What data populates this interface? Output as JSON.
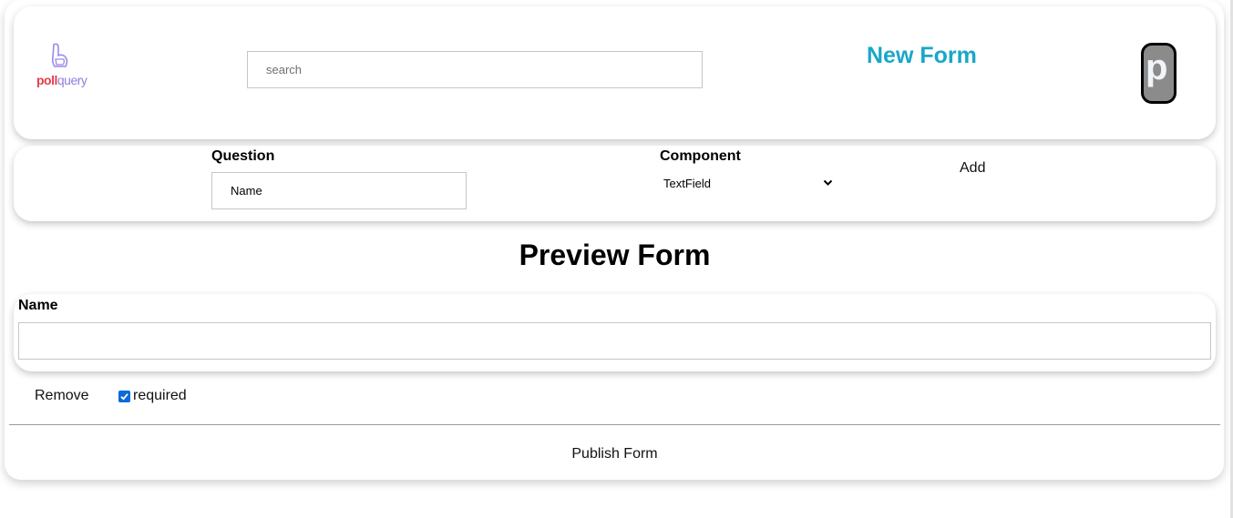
{
  "header": {
    "logo_poll": "poll",
    "logo_query": "query",
    "search_placeholder": "search",
    "form_title": "New Form",
    "avatar_letter": "p"
  },
  "builder": {
    "question_label": "Question",
    "question_value": "Name",
    "component_label": "Component",
    "component_selected": "TextField",
    "add_label": "Add"
  },
  "preview": {
    "heading": "Preview Form",
    "field_label": "Name",
    "field_value": "",
    "remove_label": "Remove",
    "required_label": "required",
    "required_checked": true
  },
  "footer": {
    "publish_label": "Publish Form"
  },
  "colors": {
    "title_accent": "#18a7c9",
    "logo_poll": "#e34049",
    "logo_query": "#8f7ee0",
    "checkbox": "#0b6ad8"
  },
  "icons": {
    "logo": "pollquery-logo-icon",
    "select": "chevron-down-icon",
    "checkbox": "check-icon"
  }
}
